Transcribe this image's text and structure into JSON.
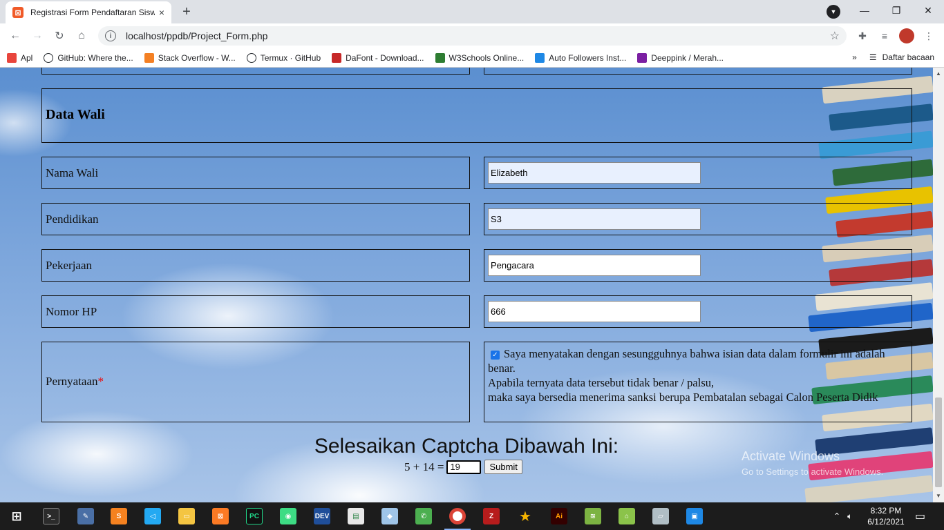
{
  "browser": {
    "tab_title": "Registrasi Form Pendaftaran Siswa",
    "tab_close": "×",
    "new_tab": "+",
    "url": "localhost/ppdb/Project_Form.php",
    "bookmarks": [
      {
        "label": "Apl",
        "icon": "apps-grid-icon",
        "color": "#e8453c"
      },
      {
        "label": "GitHub: Where the...",
        "icon": "github-icon",
        "color": "#ffffff"
      },
      {
        "label": "Stack Overflow - W...",
        "icon": "stackoverflow-icon",
        "color": "#f48024"
      },
      {
        "label": "Termux · GitHub",
        "icon": "github-icon",
        "color": "#ffffff"
      },
      {
        "label": "DaFont - Download...",
        "icon": "dafont-icon",
        "color": "#c62828"
      },
      {
        "label": "W3Schools Online...",
        "icon": "w3schools-icon",
        "color": "#2e7d32"
      },
      {
        "label": "Auto Followers Inst...",
        "icon": "cube-icon",
        "color": "#1e88e5"
      },
      {
        "label": "Deeppink / Merah...",
        "icon": "gift-icon",
        "color": "#7b1fa2"
      }
    ],
    "reading_list": "Daftar bacaan",
    "more_bookmarks": "»"
  },
  "form": {
    "section_title": "Data Wali",
    "rows": [
      {
        "label": "Nama Wali",
        "value": "Elizabeth",
        "autofill": true
      },
      {
        "label": "Pendidikan",
        "value": "S3",
        "autofill": true
      },
      {
        "label": "Pekerjaan",
        "value": "Pengacara",
        "autofill": false
      },
      {
        "label": "Nomor HP",
        "value": "666",
        "autofill": false
      }
    ],
    "statement": {
      "label": "Pernyataan",
      "required_mark": "*",
      "checked": true,
      "line1": "Saya menyatakan dengan sesungguhnya bahwa isian data dalam formulir ini adalah benar.",
      "line2": "Apabila ternyata data tersebut tidak benar / palsu,",
      "line3": "maka saya bersedia menerima sanksi berupa Pembatalan sebagai Calon Peserta Didik"
    }
  },
  "captcha": {
    "title": "Selesaikan Captcha Dibawah Ini:",
    "question": "5 + 14 =",
    "answer": "19",
    "submit_label": "Submit"
  },
  "watermark": {
    "line1": "Activate Windows",
    "line2": "Go to Settings to activate Windows."
  },
  "taskbar": {
    "time": "8:32 PM",
    "date": "6/12/2021"
  }
}
